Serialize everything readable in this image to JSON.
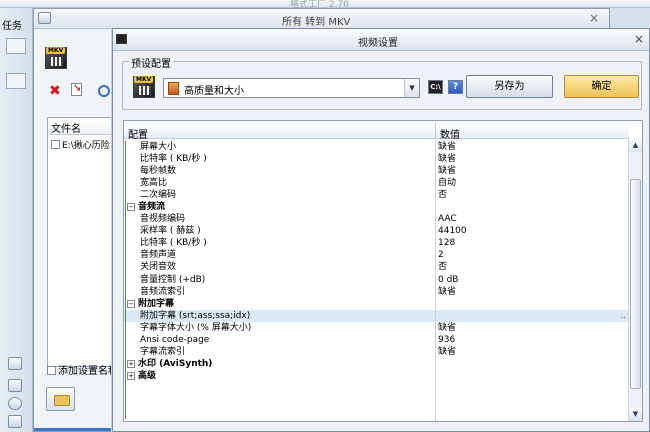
{
  "background": {
    "top_title": "格式工厂 2.70",
    "left_tab": "任务"
  },
  "middle_window": {
    "title": "所有 转到 MKV",
    "file_header": "文件名",
    "file_row": "E:\\揪心历险",
    "add_setting": "添加设置名称"
  },
  "dialog": {
    "title": "视频设置",
    "preset_legend": "预设配置",
    "preset_value": "高质量和大小",
    "help_label": "?",
    "cmd_label": "C:\\",
    "save_as_label": "另存为",
    "ok_label": "确定"
  },
  "grid": {
    "col_name": "配置",
    "col_value": "数值",
    "rows": [
      {
        "name": "屏幕大小",
        "value": "缺省"
      },
      {
        "name": "比特率 ( KB/秒 )",
        "value": "缺省"
      },
      {
        "name": "每秒帧数",
        "value": "缺省"
      },
      {
        "name": "宽高比",
        "value": "自动"
      },
      {
        "name": "二次编码",
        "value": "否"
      },
      {
        "name": "音频流",
        "value": "",
        "toggle": "−"
      },
      {
        "name": "音视频编码",
        "value": "AAC"
      },
      {
        "name": "采样率 ( 赫兹 )",
        "value": "44100"
      },
      {
        "name": "比特率 ( KB/秒 )",
        "value": "128"
      },
      {
        "name": "音频声道",
        "value": "2"
      },
      {
        "name": "关闭音效",
        "value": "否"
      },
      {
        "name": "音量控制 (+dB)",
        "value": "0 dB"
      },
      {
        "name": "音频流索引",
        "value": "缺省"
      },
      {
        "name": "附加字幕",
        "value": "",
        "toggle": "−"
      },
      {
        "name": "附加字幕 (srt;ass;ssa;idx)",
        "value": "",
        "dots": ".."
      },
      {
        "name": "字幕字体大小 (% 屏幕大小)",
        "value": "缺省"
      },
      {
        "name": "Ansi code-page",
        "value": "936"
      },
      {
        "name": "字幕流索引",
        "value": "缺省"
      },
      {
        "name": "水印 (AviSynth)",
        "value": "",
        "toggle": "+"
      },
      {
        "name": "高级",
        "value": "",
        "toggle": "+"
      }
    ]
  }
}
